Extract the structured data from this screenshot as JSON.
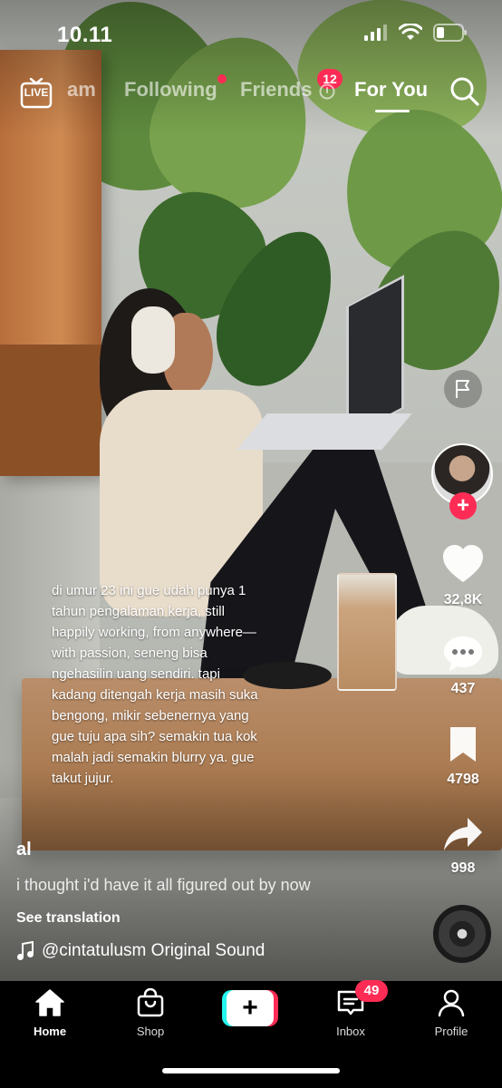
{
  "status_bar": {
    "time": "10.11"
  },
  "top_nav": {
    "live_label": "LIVE",
    "tabs": [
      {
        "label": "am"
      },
      {
        "label": "Following"
      },
      {
        "label": "Friends"
      },
      {
        "label": "For You"
      }
    ],
    "friends_badge": "12",
    "active_tab": "For You"
  },
  "video": {
    "burned_caption": "di umur 23 ini gue udah punya 1 tahun pengalaman kerja, still happily working, from anywhere—with passion, seneng bisa ngehasilin uang sendiri. tapi kadang ditengah kerja masih suka bengong, mikir sebenernya yang gue tuju apa sih? semakin tua kok malah jadi semakin blurry ya. gue takut jujur."
  },
  "post": {
    "username": "al",
    "description": "i thought i'd have it all figured out by now",
    "see_translation": "See translation",
    "sound": "@cintatulusm Original Sound"
  },
  "actions": {
    "likes": "32,8K",
    "comments": "437",
    "saves": "4798",
    "shares": "998"
  },
  "bottom_nav": {
    "items": [
      {
        "label": "Home",
        "icon": "home-icon"
      },
      {
        "label": "Shop",
        "icon": "shopping-bag-icon"
      },
      {
        "label": "",
        "icon": "create-icon"
      },
      {
        "label": "Inbox",
        "icon": "inbox-icon"
      },
      {
        "label": "Profile",
        "icon": "profile-icon"
      }
    ],
    "inbox_badge": "49"
  },
  "colors": {
    "accent": "#fe2c55",
    "cyan": "#25f4ee"
  }
}
